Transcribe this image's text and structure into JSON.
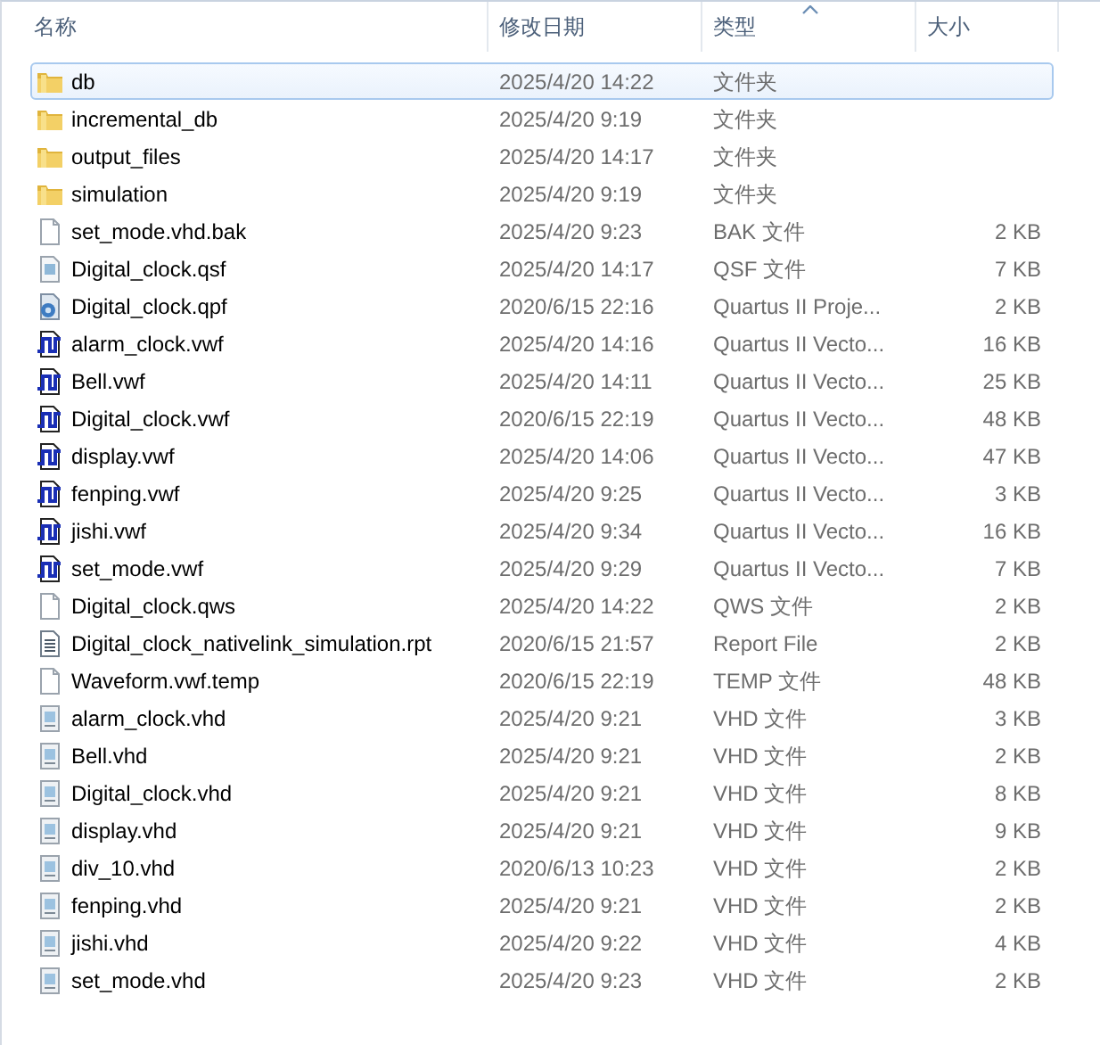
{
  "columns": [
    {
      "label": "名称",
      "sorted": false
    },
    {
      "label": "修改日期",
      "sorted": false
    },
    {
      "label": "类型",
      "sorted": true
    },
    {
      "label": "大小",
      "sorted": false
    }
  ],
  "files": [
    {
      "name": "db",
      "date": "2025/4/20 14:22",
      "type": "文件夹",
      "kind": "folder",
      "selected": true
    },
    {
      "name": "incremental_db",
      "date": "2025/4/20 9:19",
      "type": "文件夹",
      "kind": "folder",
      "selected": false
    },
    {
      "name": "output_files",
      "date": "2025/4/20 14:17",
      "type": "文件夹",
      "kind": "folder",
      "selected": false
    },
    {
      "name": "simulation",
      "date": "2025/4/20 9:19",
      "type": "文件夹",
      "kind": "folder",
      "selected": false
    },
    {
      "name": "set_mode.vhd.bak",
      "date": "2025/4/20 9:23",
      "type": "BAK 文件",
      "size": "2 KB",
      "kind": "blank",
      "selected": false
    },
    {
      "name": "Digital_clock.qsf",
      "date": "2025/4/20 14:17",
      "type": "QSF 文件",
      "size": "7 KB",
      "kind": "settings",
      "selected": false
    },
    {
      "name": "Digital_clock.qpf",
      "date": "2020/6/15 22:16",
      "type": "Quartus II Proje...",
      "size": "2 KB",
      "kind": "project",
      "selected": false
    },
    {
      "name": "alarm_clock.vwf",
      "date": "2025/4/20 14:16",
      "type": "Quartus II Vecto...",
      "size": "16 KB",
      "kind": "wave",
      "selected": false
    },
    {
      "name": "Bell.vwf",
      "date": "2025/4/20 14:11",
      "type": "Quartus II Vecto...",
      "size": "25 KB",
      "kind": "wave",
      "selected": false
    },
    {
      "name": "Digital_clock.vwf",
      "date": "2020/6/15 22:19",
      "type": "Quartus II Vecto...",
      "size": "48 KB",
      "kind": "wave",
      "selected": false
    },
    {
      "name": "display.vwf",
      "date": "2025/4/20 14:06",
      "type": "Quartus II Vecto...",
      "size": "47 KB",
      "kind": "wave",
      "selected": false
    },
    {
      "name": "fenping.vwf",
      "date": "2025/4/20 9:25",
      "type": "Quartus II Vecto...",
      "size": "3 KB",
      "kind": "wave",
      "selected": false
    },
    {
      "name": "jishi.vwf",
      "date": "2025/4/20 9:34",
      "type": "Quartus II Vecto...",
      "size": "16 KB",
      "kind": "wave",
      "selected": false
    },
    {
      "name": "set_mode.vwf",
      "date": "2025/4/20 9:29",
      "type": "Quartus II Vecto...",
      "size": "7 KB",
      "kind": "wave",
      "selected": false
    },
    {
      "name": "Digital_clock.qws",
      "date": "2025/4/20 14:22",
      "type": "QWS 文件",
      "size": "2 KB",
      "kind": "blank",
      "selected": false
    },
    {
      "name": "Digital_clock_nativelink_simulation.rpt",
      "date": "2020/6/15 21:57",
      "type": "Report File",
      "size": "2 KB",
      "kind": "text",
      "selected": false
    },
    {
      "name": "Waveform.vwf.temp",
      "date": "2020/6/15 22:19",
      "type": "TEMP 文件",
      "size": "48 KB",
      "kind": "blank",
      "selected": false
    },
    {
      "name": "alarm_clock.vhd",
      "date": "2025/4/20 9:21",
      "type": "VHD 文件",
      "size": "3 KB",
      "kind": "vhd",
      "selected": false
    },
    {
      "name": "Bell.vhd",
      "date": "2025/4/20 9:21",
      "type": "VHD 文件",
      "size": "2 KB",
      "kind": "vhd",
      "selected": false
    },
    {
      "name": "Digital_clock.vhd",
      "date": "2025/4/20 9:21",
      "type": "VHD 文件",
      "size": "8 KB",
      "kind": "vhd",
      "selected": false
    },
    {
      "name": "display.vhd",
      "date": "2025/4/20 9:21",
      "type": "VHD 文件",
      "size": "9 KB",
      "kind": "vhd",
      "selected": false
    },
    {
      "name": "div_10.vhd",
      "date": "2020/6/13 10:23",
      "type": "VHD 文件",
      "size": "2 KB",
      "kind": "vhd",
      "selected": false
    },
    {
      "name": "fenping.vhd",
      "date": "2025/4/20 9:21",
      "type": "VHD 文件",
      "size": "2 KB",
      "kind": "vhd",
      "selected": false
    },
    {
      "name": "jishi.vhd",
      "date": "2025/4/20 9:22",
      "type": "VHD 文件",
      "size": "4 KB",
      "kind": "vhd",
      "selected": false
    },
    {
      "name": "set_mode.vhd",
      "date": "2025/4/20 9:23",
      "type": "VHD 文件",
      "size": "2 KB",
      "kind": "vhd",
      "selected": false
    }
  ]
}
